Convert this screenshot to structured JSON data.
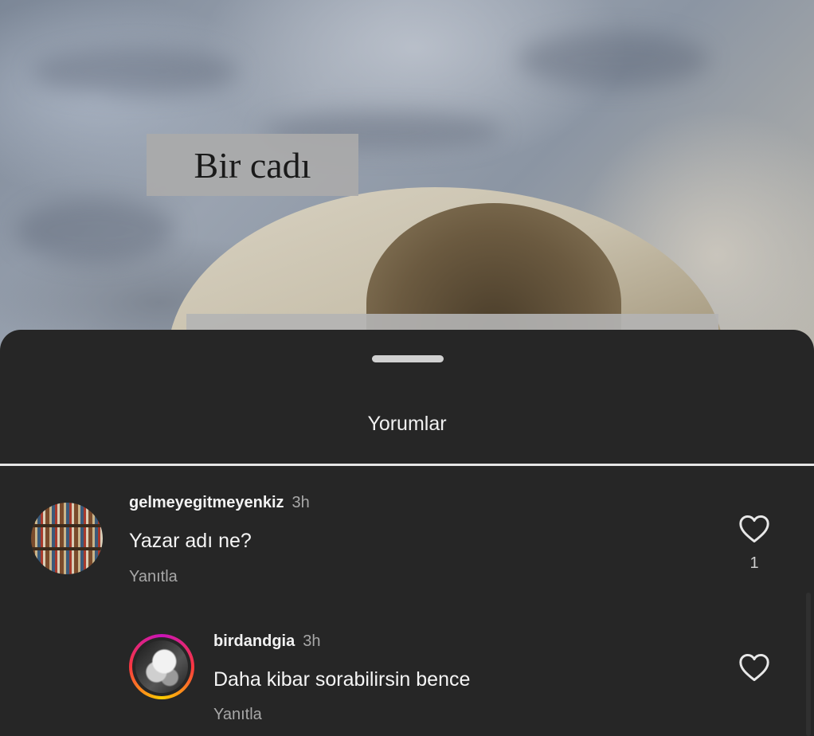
{
  "story": {
    "caption": "Bir cadı"
  },
  "comments_sheet": {
    "title": "Yorumlar",
    "comments": [
      {
        "username": "gelmeyegitmeyenkiz",
        "time": "3h",
        "text": "Yazar adı ne?",
        "reply_label": "Yanıtla",
        "like_count": "1",
        "avatar_icon": "bookshelf-avatar"
      },
      {
        "username": "birdandgia",
        "time": "3h",
        "text": "Daha kibar sorabilirsin bence",
        "reply_label": "Yanıtla",
        "avatar_icon": "story-ring-avatar"
      }
    ]
  },
  "colors": {
    "sheet_background": "#262626",
    "story_ring": "#f9373f"
  }
}
